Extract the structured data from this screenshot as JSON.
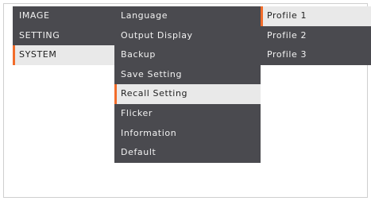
{
  "main_menu": {
    "items": [
      {
        "label": "IMAGE"
      },
      {
        "label": "SETTING"
      },
      {
        "label": "SYSTEM"
      }
    ]
  },
  "system_menu": {
    "items": [
      {
        "label": "Language"
      },
      {
        "label": "Output Display"
      },
      {
        "label": "Backup"
      },
      {
        "label": "Save Setting"
      },
      {
        "label": "Recall Setting"
      },
      {
        "label": "Flicker"
      },
      {
        "label": "Information"
      },
      {
        "label": "Default"
      }
    ]
  },
  "profile_menu": {
    "items": [
      {
        "label": "Profile 1"
      },
      {
        "label": "Profile 2"
      },
      {
        "label": "Profile 3"
      }
    ]
  },
  "colors": {
    "menu_bg": "#4a4a4f",
    "selected_bg": "#e9e9e9",
    "accent": "#f26c2a"
  }
}
